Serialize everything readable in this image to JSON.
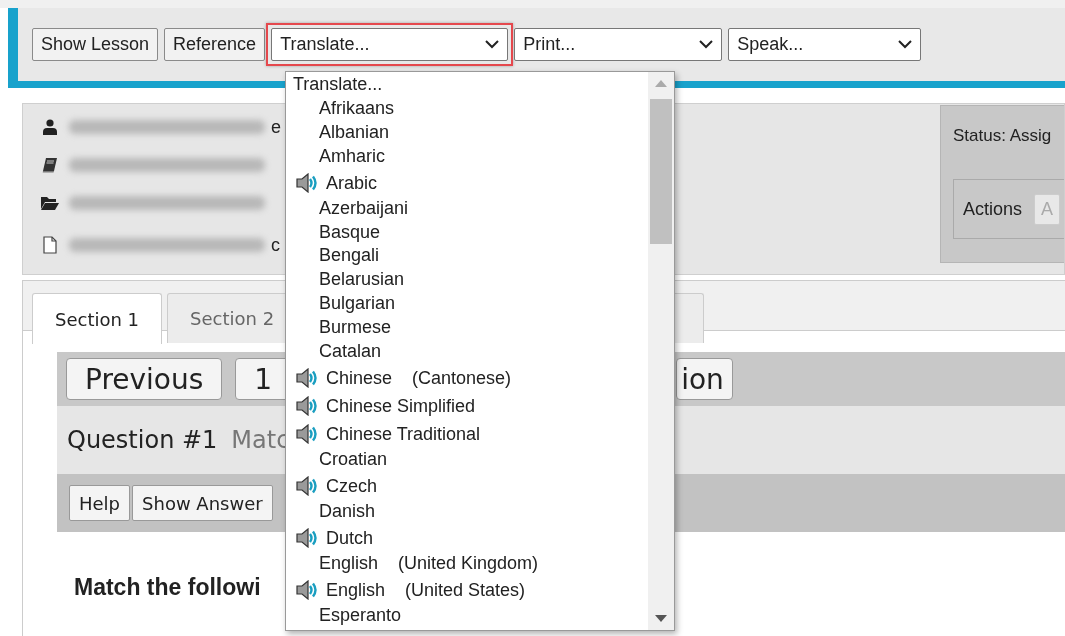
{
  "toolbar": {
    "buttons": [
      "Show Lesson",
      "Reference"
    ],
    "selects": [
      {
        "value": "Translate...",
        "highlighted": true
      },
      {
        "value": "Print...",
        "highlighted": false
      },
      {
        "value": "Speak...",
        "highlighted": false
      }
    ]
  },
  "info": {
    "lines": [
      {
        "kind": "user",
        "tail": "e"
      },
      {
        "kind": "book"
      },
      {
        "kind": "folder"
      },
      {
        "kind": "file",
        "tail": "c"
      }
    ]
  },
  "status": {
    "label": "Status: Assig",
    "actions_label": "Actions",
    "actions_value": "A"
  },
  "sections": {
    "tabs": [
      {
        "label": "Section 1",
        "selected": true
      },
      {
        "label": "Section 2",
        "selected": false
      },
      {
        "selected": false
      }
    ]
  },
  "navigation": {
    "buttons": [
      {
        "label": "Previous",
        "kind": "full"
      },
      {
        "label": "1",
        "kind": "full"
      },
      {
        "label": "ion",
        "kind": "cut"
      }
    ]
  },
  "question": {
    "title": "Question #1",
    "subtitle": "Matc",
    "buttons": [
      "Help",
      "Show Answer"
    ],
    "prompt": "Match the followi"
  },
  "translate_menu": {
    "items": [
      {
        "label": "Translate...",
        "kind": "header"
      },
      {
        "label": "Afrikaans",
        "kind": "plain"
      },
      {
        "label": "Albanian",
        "kind": "plain"
      },
      {
        "label": "Amharic",
        "kind": "plain"
      },
      {
        "label": "Arabic",
        "kind": "speak"
      },
      {
        "label": "Azerbaijani",
        "kind": "plain"
      },
      {
        "label": "Basque",
        "kind": "plain"
      },
      {
        "label": "Bengali",
        "kind": "plain"
      },
      {
        "label": "Belarusian",
        "kind": "plain"
      },
      {
        "label": "Bulgarian",
        "kind": "plain"
      },
      {
        "label": "Burmese",
        "kind": "plain"
      },
      {
        "label": "Catalan",
        "kind": "plain"
      },
      {
        "label": "Chinese    (Cantonese)",
        "kind": "speak"
      },
      {
        "label": "Chinese Simplified",
        "kind": "speak"
      },
      {
        "label": "Chinese Traditional",
        "kind": "speak"
      },
      {
        "label": "Croatian",
        "kind": "plain"
      },
      {
        "label": "Czech",
        "kind": "speak"
      },
      {
        "label": "Danish",
        "kind": "plain"
      },
      {
        "label": "Dutch",
        "kind": "speak"
      },
      {
        "label": "English    (United Kingdom)",
        "kind": "plain"
      },
      {
        "label": "English    (United States)",
        "kind": "speak"
      },
      {
        "label": "Esperanto",
        "kind": "plain"
      }
    ]
  }
}
